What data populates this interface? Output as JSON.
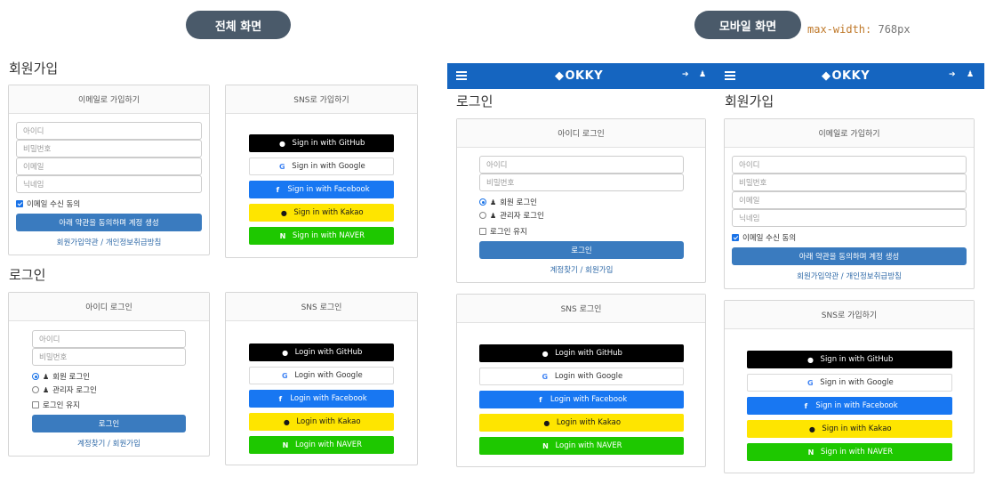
{
  "labels": {
    "desktop": "전체 화면",
    "mobile": "모바일 화면",
    "mq_prop": "max-width:",
    "mq_val": " 768px"
  },
  "signup": {
    "section_title": "회원가입",
    "email_head": "이메일로 가입하기",
    "placeholders": [
      "아이디",
      "비밀번호",
      "이메일",
      "닉네임"
    ],
    "email_consent": "이메일 수신 동의",
    "submit": "아래 약관을 동의하며 계정 생성",
    "terms_link": "회원가입약관 / 개인정보취급방침",
    "sns_head": "SNS로 가입하기",
    "sns": [
      {
        "name": "github",
        "label": "Sign in with GitHub"
      },
      {
        "name": "google",
        "label": "Sign in with Google"
      },
      {
        "name": "facebook",
        "label": "Sign in with Facebook"
      },
      {
        "name": "kakao",
        "label": "Sign in with Kakao"
      },
      {
        "name": "naver",
        "label": "Sign in with NAVER"
      }
    ]
  },
  "login": {
    "section_title": "로그인",
    "id_head": "아이디 로그인",
    "placeholders": [
      "아이디",
      "비밀번호"
    ],
    "radio_member": "회원 로그인",
    "radio_admin": "관리자 로그인",
    "keep_login": "로그인 유지",
    "submit": "로그인",
    "find_link": "계정찾기 / 회원가입",
    "sns_head": "SNS 로그인",
    "sns": [
      {
        "name": "github",
        "label": "Login with GitHub"
      },
      {
        "name": "google",
        "label": "Login with Google"
      },
      {
        "name": "facebook",
        "label": "Login with Facebook"
      },
      {
        "name": "kakao",
        "label": "Login with Kakao"
      },
      {
        "name": "naver",
        "label": "Login with NAVER"
      }
    ]
  },
  "navbar": {
    "logo": "OKKY",
    "color": "#1565c0"
  }
}
